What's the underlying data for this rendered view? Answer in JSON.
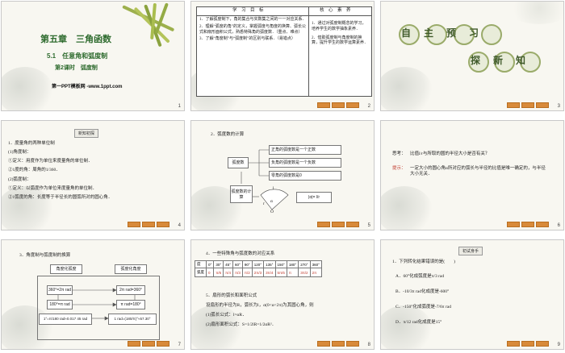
{
  "slides": [
    {
      "num": "1",
      "chapter": "第五章　三角函数",
      "section": "5.1　任意角和弧度制",
      "subsection": "第2课时　弧度制",
      "brand": "第一PPT模板网 -www.1ppt.com"
    },
    {
      "num": "2",
      "col1_header": "学　习　目　标",
      "col2_header": "核　心　素　养",
      "goals": [
        "1．了解弧度制下，角的集合与实数集之间的一一对应关系．",
        "2．理解“弧度的角”的定义，掌握弧度与角度的换算、弧长公式和扇形面积公式，熟悉特殊角的弧度数．（重点、难点）",
        "3．了解“角度制”与“弧度制”的区别与联系．（易错点）"
      ],
      "literacy": [
        "1．通过对弧度制概念的学习，培养学生的数学抽象素养．",
        "2．借助弧度制与角度制的换算，提升学生的数学运算素养．"
      ]
    },
    {
      "num": "3",
      "title1": "自　主　预　习",
      "title2": "探　新　知"
    },
    {
      "num": "4",
      "tag": "新知初探",
      "lines": [
        "1．度量角的两种单位制",
        "(1)角度制：",
        "①定义：用度作为单位来度量角的单位制．",
        "②1度的角：周角的1/360．",
        "(2)弧度制：",
        "①定义：以弧度作为单位来度量角的单位制．",
        "②1弧度的角：长度等于半径长的圆弧所对的圆心角．"
      ]
    },
    {
      "num": "5",
      "heading": "2．弧度数的计算",
      "box_a": "弧度数",
      "box_b": "弧度数的计算",
      "r1": "正角的弧度数是一个正数",
      "r2": "负角的弧度数是一个负数",
      "r3": "零角的弧度数是0",
      "formula": "|α|= l/r",
      "arc_l": "l",
      "arc_r": "r",
      "arc_o": "O",
      "arc_a": "α"
    },
    {
      "num": "6",
      "q_label": "思考：",
      "q_text": "比值l/r与所取的圆的半径大小是否有关？",
      "h_label": "提示：",
      "h_text": "一定大小的圆心角α所对应的弧长与半径的比值是唯一确定的，与半径大小无关．"
    },
    {
      "num": "7",
      "heading": "3．角度制与弧度制的换算",
      "top_a": "角度化弧度",
      "top_b": "弧度化角度",
      "rows": [
        [
          "360°=2π rad",
          "2π rad=360°"
        ],
        [
          "180°=π rad",
          "π rad=180°"
        ],
        [
          "1°=π/180 rad≈0.017 45 rad",
          "1 rad=(180/π)°≈57.30°"
        ]
      ]
    },
    {
      "num": "8",
      "heading": "4．一些特殊角与弧度数的对应关系",
      "deg_label": "度",
      "rad_label": "弧度",
      "degs": [
        "0°",
        "30°",
        "45°",
        "60°",
        "90°",
        "120°",
        "135°",
        "150°",
        "180°",
        "270°",
        "360°"
      ],
      "rads": [
        "0",
        "π/6",
        "π/4",
        "π/3",
        "π/2",
        "2π/3",
        "3π/4",
        "5π/6",
        "π",
        "3π/2",
        "2π"
      ],
      "h2": "5．扇形的弧长和面积公式",
      "p1": "设扇形的半径为R，弧长为l，α(0<α<2π)为其圆心角，则",
      "p2": "(1)弧长公式：l=αR．",
      "p3": "(2)扇形面积公式：S=1/2lR=1/2αR²．"
    },
    {
      "num": "9",
      "tag": "初试身手",
      "q": "1．下列转化结果错误的是(　　)",
      "opts": [
        "A．60°化成弧度是π/3 rad",
        "B．-10/3π rad化成度是-600°",
        "C．-150°化成弧度是-7/6π rad",
        "D．π/12 rad化成度是15°"
      ]
    }
  ],
  "colors": {
    "accent": "#c0392b",
    "title_green": "#2e6b2e",
    "nav": "#d88a3a"
  }
}
